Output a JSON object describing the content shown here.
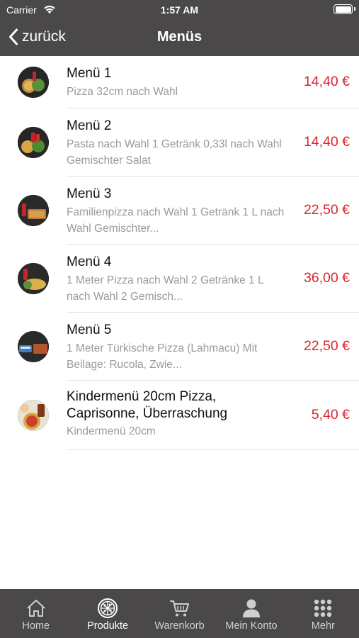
{
  "status_bar": {
    "carrier": "Carrier",
    "time": "1:57 AM"
  },
  "nav": {
    "back_label": "zurück",
    "title": "Menüs"
  },
  "colors": {
    "bar_background": "#4a4848",
    "price": "#d8262c",
    "description": "#9a9a9a"
  },
  "menu_items": [
    {
      "title": "Menü 1",
      "description": "Pizza 32cm nach Wahl",
      "price": "14,40 €",
      "image": "pizza-with-drink-thumbnail"
    },
    {
      "title": "Menü 2",
      "description": "Pasta nach Wahl 1 Getränk 0,33l nach Wahl Gemischter Salat",
      "price": "14,40 €",
      "image": "pasta-with-drink-thumbnail"
    },
    {
      "title": "Menü 3",
      "description": "Familienpizza nach Wahl 1 Getränk 1 L nach Wahl Gemischter...",
      "price": "22,50 €",
      "image": "family-pizza-thumbnail"
    },
    {
      "title": "Menü 4",
      "description": "1 Meter Pizza nach Wahl 2 Getränke 1 L nach Wahl 2 Gemisch...",
      "price": "36,00 €",
      "image": "meter-pizza-thumbnail"
    },
    {
      "title": "Menü 5",
      "description": "1 Meter Türkische Pizza (Lahmacu) Mit Beilage: Rucola, Zwie...",
      "price": "22,50 €",
      "image": "lahmacun-thumbnail"
    },
    {
      "title": "Kindermenü 20cm Pizza, Caprisonne, Überraschung",
      "description": "Kindermenü 20cm",
      "price": "5,40 €",
      "image": "kids-menu-thumbnail"
    }
  ],
  "tabbar": {
    "tabs": [
      {
        "label": "Home",
        "icon": "home-icon",
        "active": false
      },
      {
        "label": "Produkte",
        "icon": "pizza-icon",
        "active": true
      },
      {
        "label": "Warenkorb",
        "icon": "cart-icon",
        "active": false
      },
      {
        "label": "Mein Konto",
        "icon": "person-icon",
        "active": false
      },
      {
        "label": "Mehr",
        "icon": "grid-icon",
        "active": false
      }
    ]
  }
}
